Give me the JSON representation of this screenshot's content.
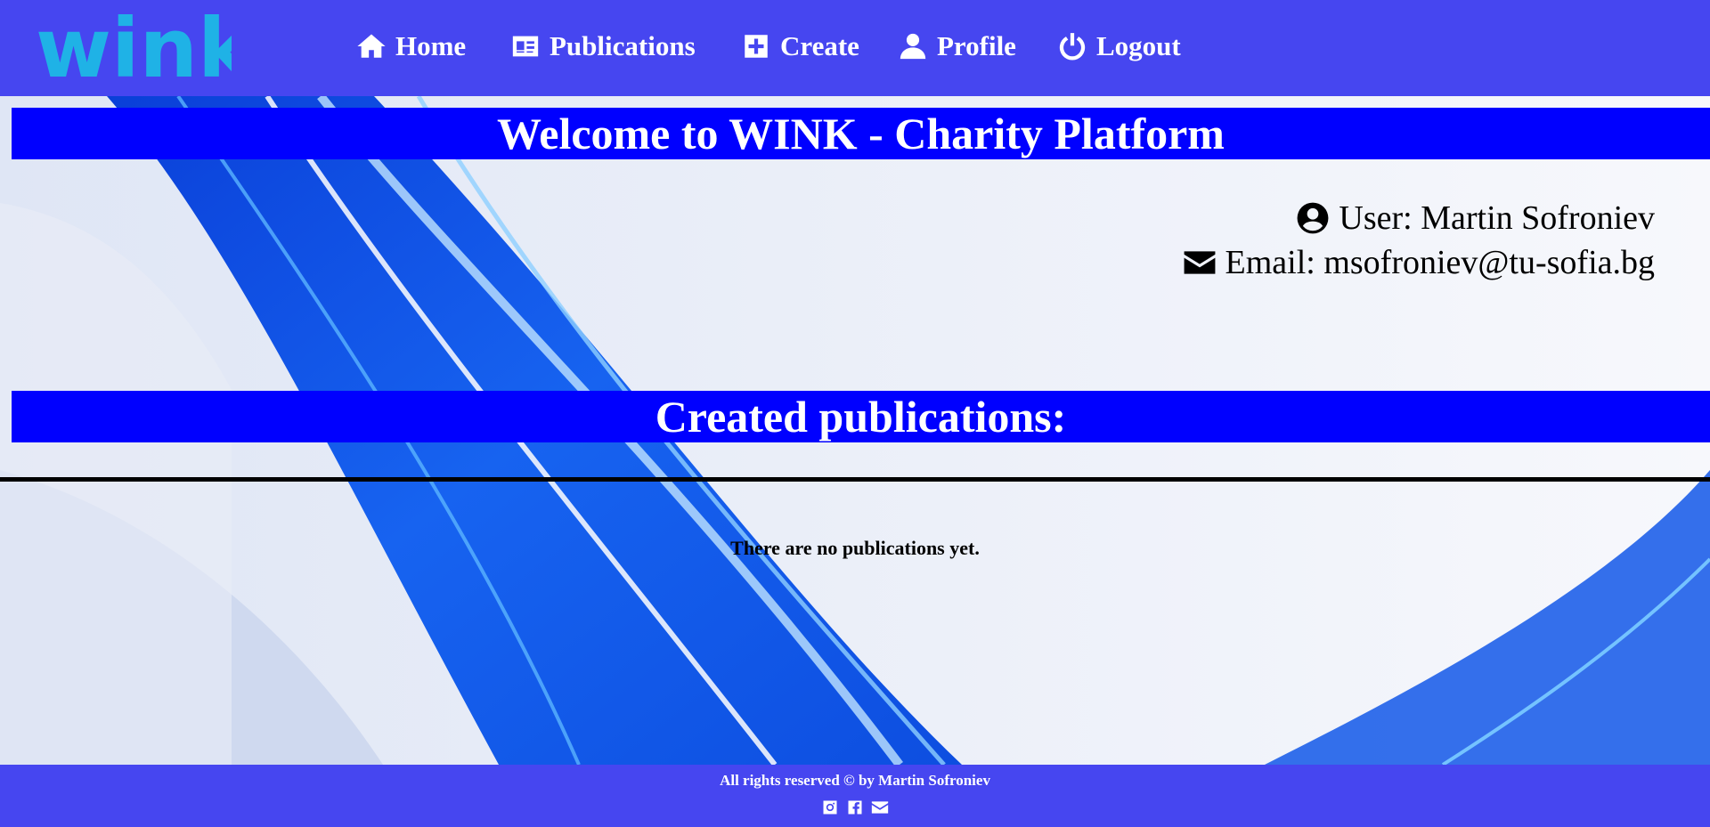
{
  "brand": {
    "logo_text": "wink",
    "logo_color": "#1fb2e6"
  },
  "nav": {
    "items": [
      {
        "label": "Home",
        "icon": "home-icon"
      },
      {
        "label": "Publications",
        "icon": "id-card-icon"
      },
      {
        "label": "Create",
        "icon": "plus-square-icon"
      },
      {
        "label": "Profile",
        "icon": "user-icon"
      },
      {
        "label": "Logout",
        "icon": "power-icon"
      }
    ],
    "background": "#4646f0"
  },
  "welcome": {
    "title": "Welcome to WINK - Charity Platform"
  },
  "user": {
    "name_line": "User: Martin Sofroniev",
    "email_line": "Email: msofroniev@tu-sofia.bg"
  },
  "publications": {
    "title": "Created publications:",
    "empty_message": "There are no publications yet."
  },
  "footer": {
    "text": "All rights reserved © by Martin Sofroniev",
    "icons": [
      "instagram-icon",
      "facebook-icon",
      "envelope-icon"
    ]
  },
  "colors": {
    "banner": "#0000ff",
    "accent": "#4646f0"
  }
}
